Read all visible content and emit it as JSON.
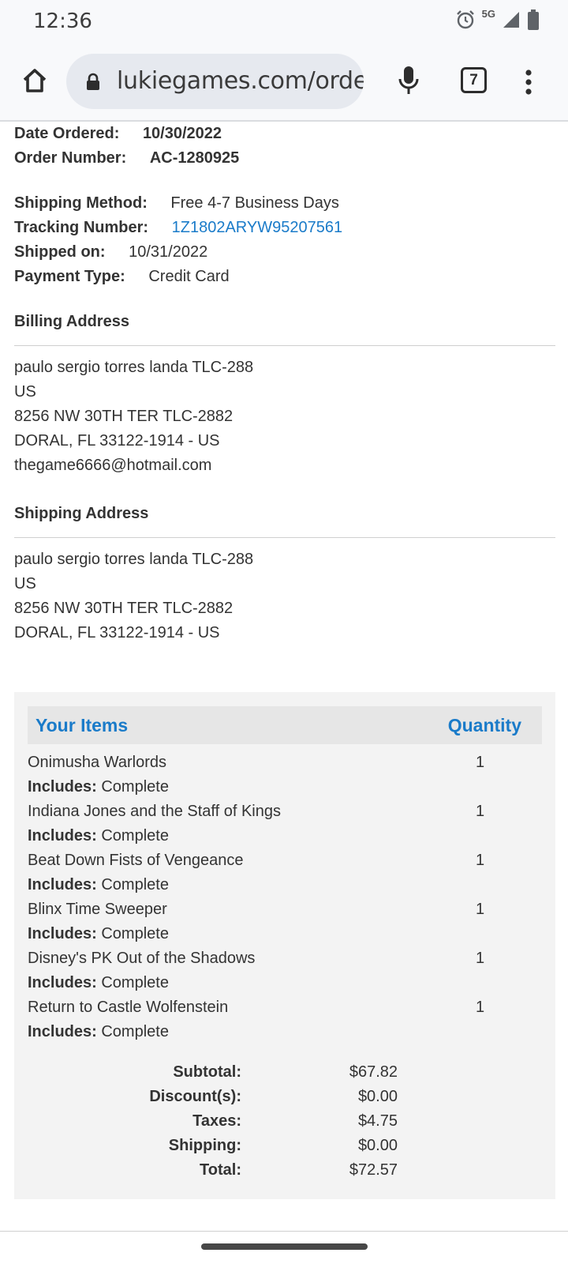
{
  "status_bar": {
    "time": "12:36",
    "network": "5G",
    "icons": [
      "alarm-icon",
      "signal-icon",
      "battery-icon"
    ]
  },
  "browser": {
    "url": "lukiegames.com/orde",
    "tab_count": "7",
    "icons": [
      "home-icon",
      "lock-icon",
      "mic-icon",
      "tabs-icon",
      "overflow-menu-icon"
    ]
  },
  "order": {
    "date_ordered_label": "Date Ordered:",
    "date_ordered": "10/30/2022",
    "order_number_label": "Order Number:",
    "order_number": "AC-1280925",
    "shipping_method_label": "Shipping Method:",
    "shipping_method": "Free 4-7 Business Days",
    "tracking_number_label": "Tracking Number:",
    "tracking_number": "1Z1802ARYW95207561",
    "shipped_on_label": "Shipped on:",
    "shipped_on": "10/31/2022",
    "payment_type_label": "Payment Type:",
    "payment_type": "Credit Card"
  },
  "billing": {
    "title": "Billing Address",
    "lines": [
      "paulo sergio torres landa TLC-288",
      "US",
      "8256 NW 30TH TER TLC-2882",
      "DORAL, FL 33122-1914 - US",
      "thegame6666@hotmail.com"
    ]
  },
  "shipping": {
    "title": "Shipping Address",
    "lines": [
      "paulo sergio torres landa TLC-288",
      "US",
      "8256 NW 30TH TER TLC-2882",
      "DORAL, FL 33122-1914 - US"
    ]
  },
  "items": {
    "header_items": "Your Items",
    "header_quantity": "Quantity",
    "includes_label": "Includes:",
    "list": [
      {
        "name": "Onimusha Warlords",
        "qty": "1",
        "includes": "Complete"
      },
      {
        "name": "Indiana Jones and the Staff of Kings",
        "qty": "1",
        "includes": "Complete"
      },
      {
        "name": "Beat Down Fists of Vengeance",
        "qty": "1",
        "includes": "Complete"
      },
      {
        "name": "Blinx Time Sweeper",
        "qty": "1",
        "includes": "Complete"
      },
      {
        "name": "Disney's PK Out of the Shadows",
        "qty": "1",
        "includes": "Complete"
      },
      {
        "name": "Return to Castle Wolfenstein",
        "qty": "1",
        "includes": "Complete"
      }
    ]
  },
  "totals": {
    "subtotal_label": "Subtotal:",
    "subtotal": "$67.82",
    "discount_label": "Discount(s):",
    "discount": "$0.00",
    "taxes_label": "Taxes:",
    "taxes": "$4.75",
    "shipping_label": "Shipping:",
    "shipping": "$0.00",
    "total_label": "Total:",
    "total": "$72.57"
  },
  "colors": {
    "link": "#1a7bc9",
    "text": "#333333",
    "items_bg": "#f3f3f3",
    "items_header_bg": "#e6e6e6"
  }
}
